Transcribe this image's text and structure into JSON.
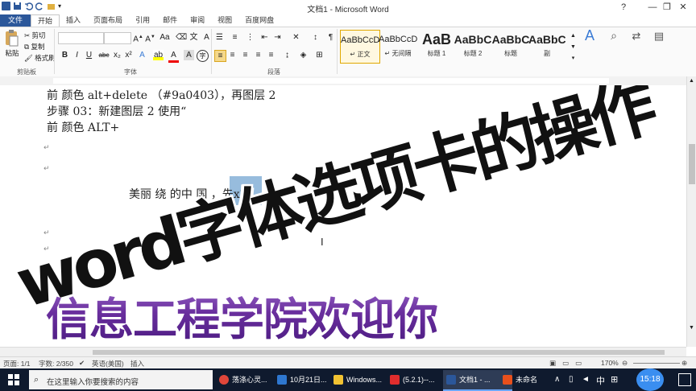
{
  "window": {
    "title": "文档1 - Microsoft Word",
    "controls": [
      "?",
      "—",
      "❐",
      "✕"
    ]
  },
  "tabs": [
    "文件",
    "开始",
    "插入",
    "页面布局",
    "引用",
    "邮件",
    "审阅",
    "视图",
    "百度网盘"
  ],
  "ribbon": {
    "clipboard": {
      "paste": "粘贴",
      "cut": "剪切",
      "copy": "复制",
      "format_painter": "格式刷",
      "label": "剪贴板"
    },
    "font": {
      "label": "字体",
      "bold": "B",
      "italic": "I",
      "underline": "U",
      "strike": "abc",
      "sub": "x₂",
      "sup": "x²"
    },
    "paragraph": {
      "label": "段落"
    },
    "styles": [
      {
        "preview": "AaBbCcD",
        "name": "↵ 正文"
      },
      {
        "preview": "AaBbCcD",
        "name": "↵ 无间隔"
      },
      {
        "preview": "AaB",
        "name": "标题 1"
      },
      {
        "preview": "AaBbC",
        "name": "标题 2"
      },
      {
        "preview": "AaBbC",
        "name": "标题"
      },
      {
        "preview": "AaBbC",
        "name": "副"
      }
    ]
  },
  "document": {
    "lines": [
      "前 颜色 alt+delete （#9a0403），再图层 2",
      "步骤 03：新建图层 2 使用“",
      "前 颜色 ALT+",
      "美丽 绕 的中 国 ，先x2"
    ],
    "overlay_title": "word字体选项卡的操作",
    "wordart": "信息工程学院欢迎你"
  },
  "status": {
    "page": "页面: 1/1",
    "words": "字数: 2/350",
    "language": "英语(美国)",
    "mode": "插入",
    "zoom": "170%"
  },
  "taskbar": {
    "search_placeholder": "在这里输入你要搜索的内容",
    "apps": [
      "荡涤心灵...",
      "10月21日...",
      "Windows...",
      "(5.2.1)--...",
      "文档1 - ...",
      "未命名"
    ],
    "ime": "中",
    "time": "15:18"
  }
}
